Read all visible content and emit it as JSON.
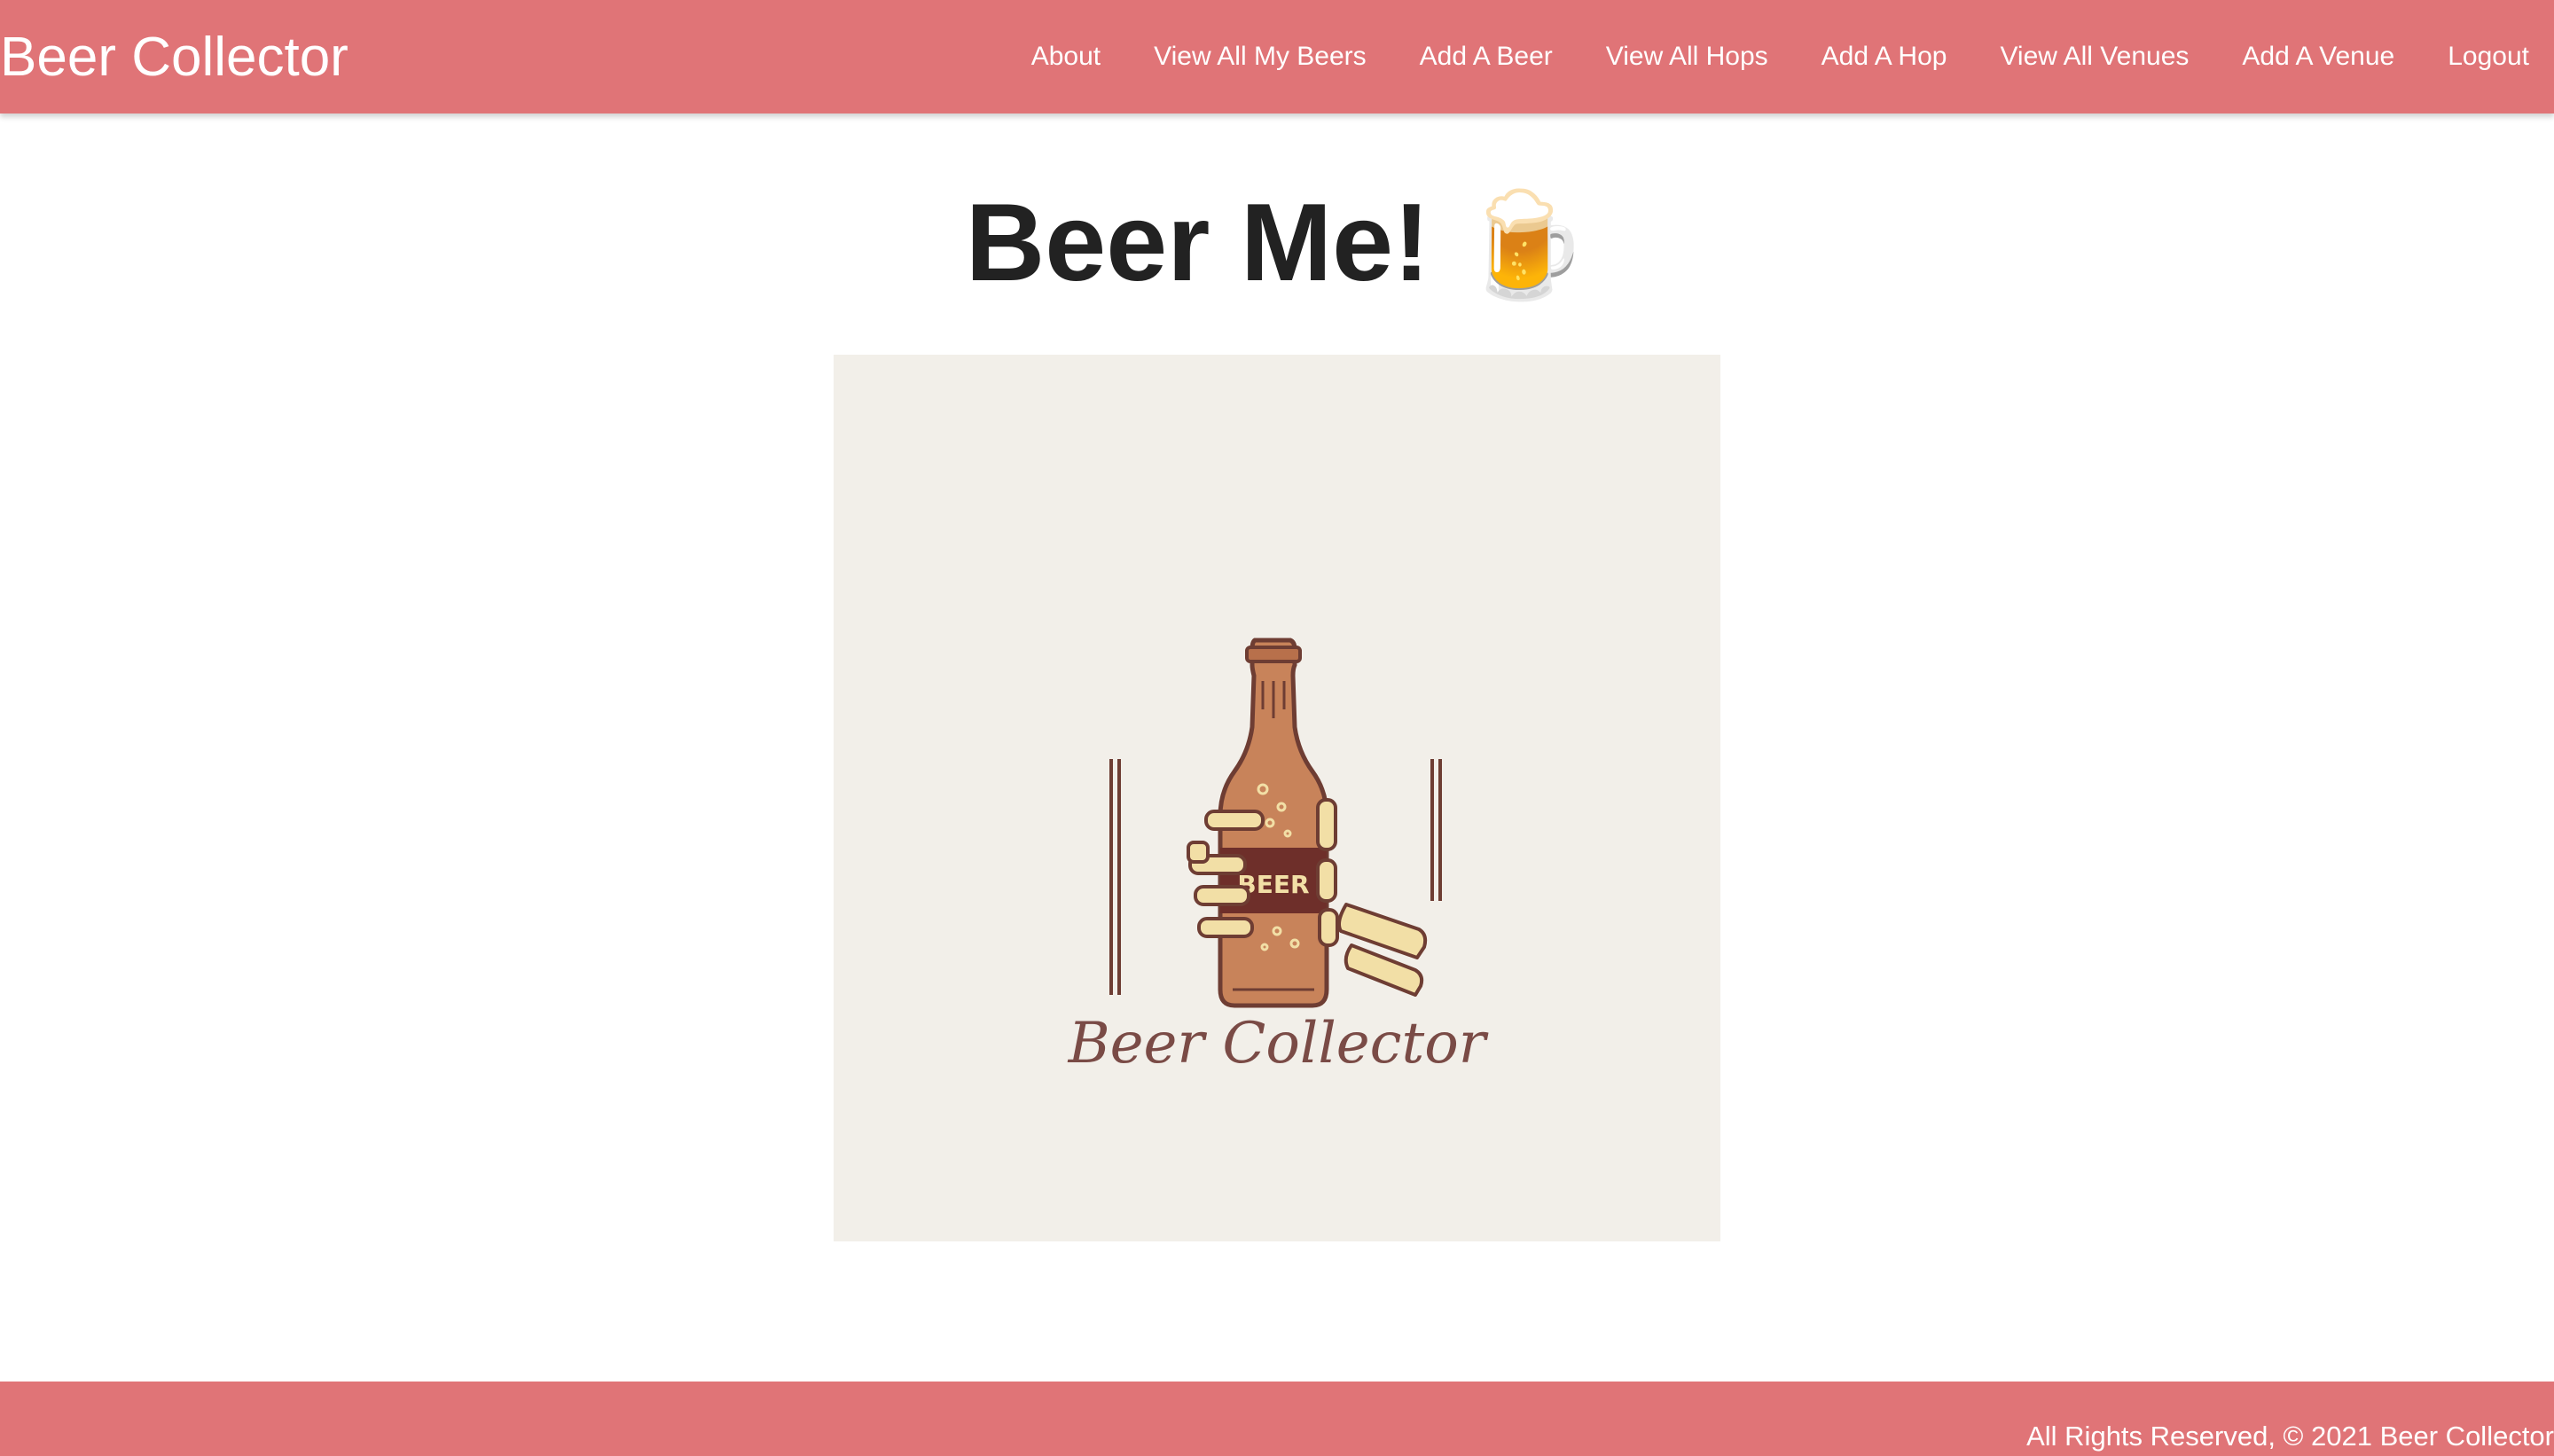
{
  "navbar": {
    "brand": "Beer Collector",
    "links": [
      {
        "label": "About"
      },
      {
        "label": "View All My Beers"
      },
      {
        "label": "Add A Beer"
      },
      {
        "label": "View All Hops"
      },
      {
        "label": "Add A Hop"
      },
      {
        "label": "View All Venues"
      },
      {
        "label": "Add A Venue"
      },
      {
        "label": "Logout"
      }
    ]
  },
  "main": {
    "title": "Beer Me!",
    "title_emoji": "🍺",
    "logo": {
      "label_text": "BEER",
      "caption": "Beer Collector"
    }
  },
  "footer": {
    "text": "All Rights Reserved, © 2021 Beer Collector"
  },
  "colors": {
    "accent": "#e07477",
    "logo_background": "#f2efe9",
    "bottle": "#c8835a",
    "bottle_outline": "#6e3d33",
    "bone": "#f2dfa6"
  },
  "icons": {
    "title_emoji": "beer-mug-icon",
    "logo": "skeleton-hand-beer-bottle-icon"
  }
}
